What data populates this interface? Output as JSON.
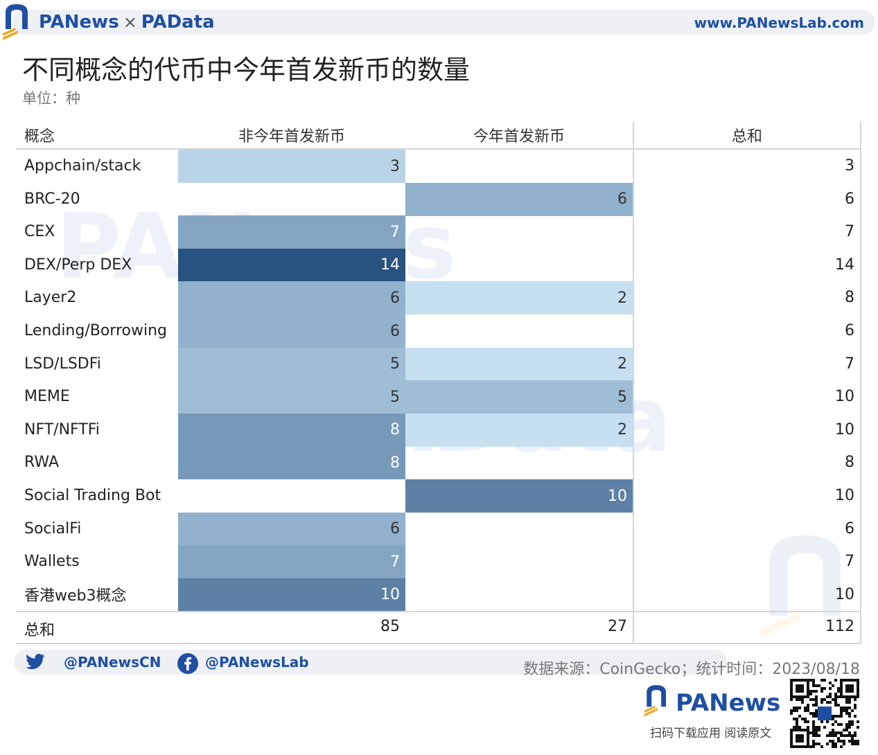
{
  "header": {
    "brand_left": "PANews",
    "brand_sep": "×",
    "brand_right": "PAData",
    "url": "www.PANewsLab.com"
  },
  "title": "不同概念的代币中今年首发新币的数量",
  "unit": "单位：种",
  "colors": {
    "brand": "#1f4fa3",
    "scale_low": "#c6e0f2",
    "scale_high": "#28527f"
  },
  "chart_data": {
    "type": "table",
    "columns": [
      "概念",
      "非今年首发新币",
      "今年首发新币",
      "总和"
    ],
    "rows": [
      {
        "category": "Appchain/stack",
        "old": 3,
        "new": null,
        "total": 3
      },
      {
        "category": "BRC-20",
        "old": null,
        "new": 6,
        "total": 6
      },
      {
        "category": "CEX",
        "old": 7,
        "new": null,
        "total": 7
      },
      {
        "category": "DEX/Perp DEX",
        "old": 14,
        "new": null,
        "total": 14
      },
      {
        "category": "Layer2",
        "old": 6,
        "new": 2,
        "total": 8
      },
      {
        "category": "Lending/Borrowing",
        "old": 6,
        "new": null,
        "total": 6
      },
      {
        "category": "LSD/LSDFi",
        "old": 5,
        "new": 2,
        "total": 7
      },
      {
        "category": "MEME",
        "old": 5,
        "new": 5,
        "total": 10
      },
      {
        "category": "NFT/NFTFi",
        "old": 8,
        "new": 2,
        "total": 10
      },
      {
        "category": "RWA",
        "old": 8,
        "new": null,
        "total": 8
      },
      {
        "category": "Social Trading Bot",
        "old": null,
        "new": 10,
        "total": 10
      },
      {
        "category": "SocialFi",
        "old": 6,
        "new": null,
        "total": 6
      },
      {
        "category": "Wallets",
        "old": 7,
        "new": null,
        "total": 7
      },
      {
        "category": "香港web3概念",
        "old": 10,
        "new": null,
        "total": 10
      }
    ],
    "totals": {
      "label": "总和",
      "old": 85,
      "new": 27,
      "total": 112
    }
  },
  "footer": {
    "twitter": "@PANewsCN",
    "facebook": "@PANewsLab",
    "source": "数据来源：CoinGecko；统计时间：2023/08/18",
    "brand": "PANews",
    "slogan": "扫码下载应用  阅读原文"
  }
}
